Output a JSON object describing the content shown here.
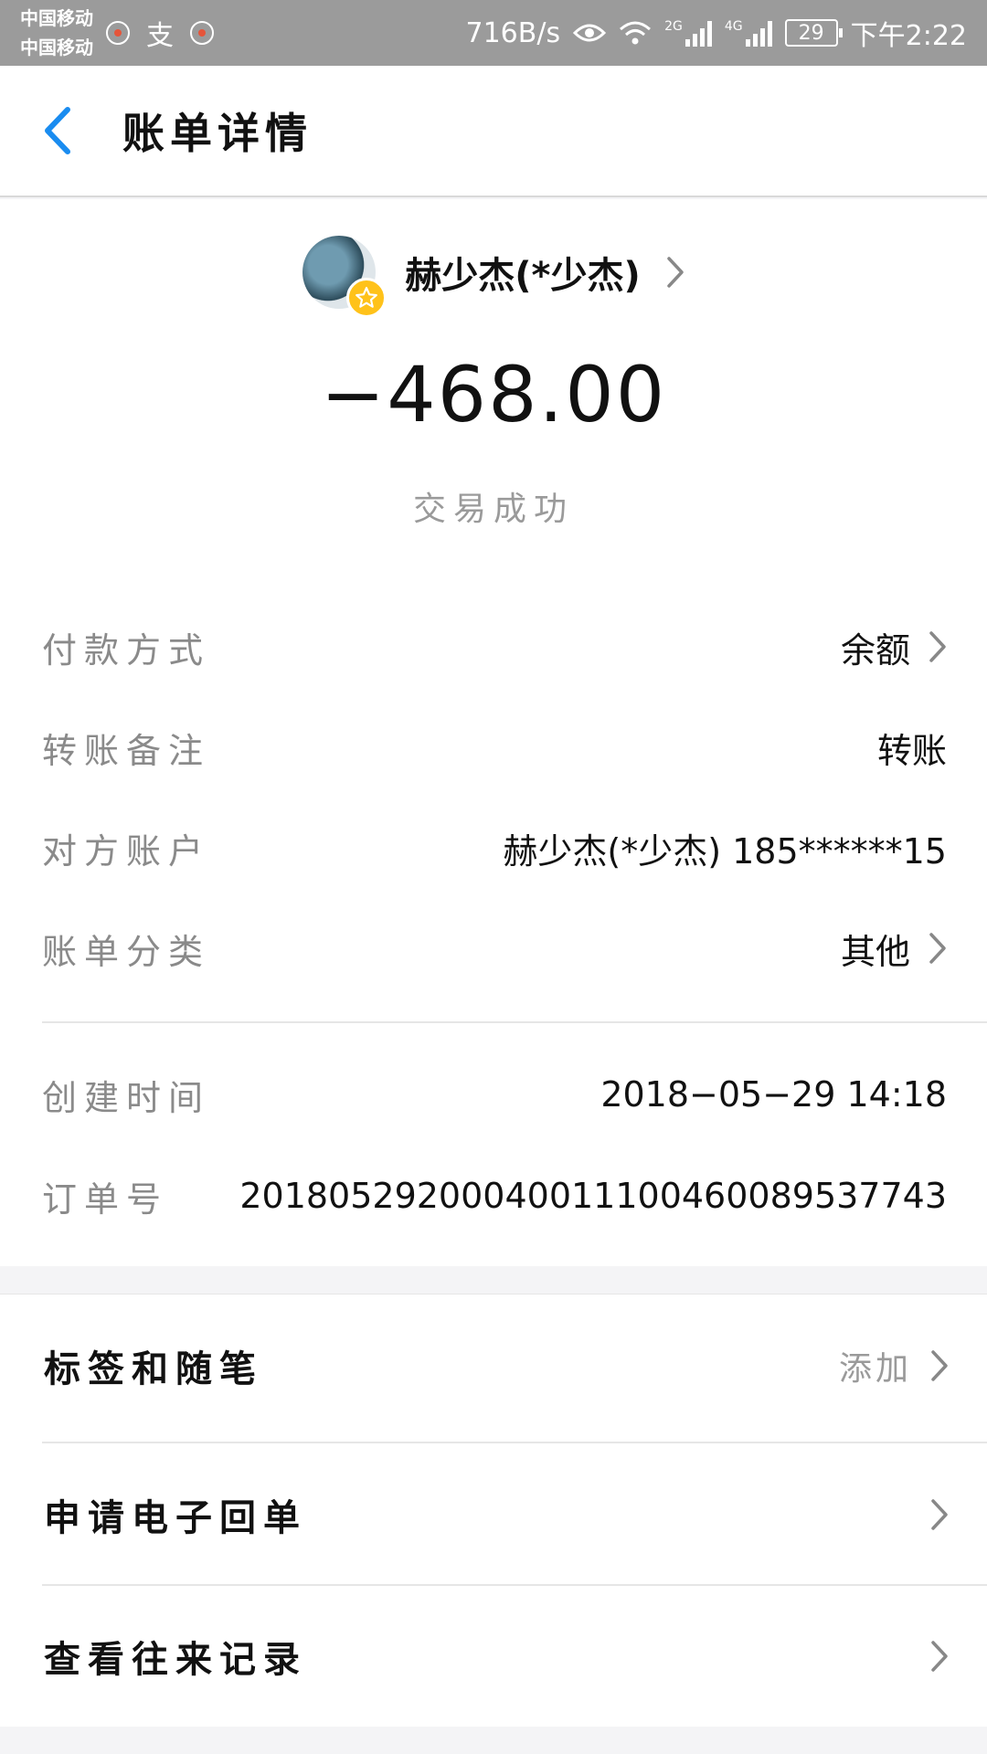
{
  "status_bar": {
    "carrier_1": "中国移动",
    "carrier_2": "中国移动",
    "app_char": "支",
    "speed": "716B/s",
    "net_2g": "2G",
    "net_4g": "4G",
    "battery": "29",
    "time": "下午2:22"
  },
  "header": {
    "title": "账单详情"
  },
  "payee": {
    "name": "赫少杰(*少杰)"
  },
  "transaction": {
    "amount": "−468.00",
    "status": "交易成功"
  },
  "details": {
    "payment_method_label": "付款方式",
    "payment_method_value": "余额",
    "note_label": "转账备注",
    "note_value": "转账",
    "account_label": "对方账户",
    "account_value": "赫少杰(*少杰) 185******15",
    "category_label": "账单分类",
    "category_value": "其他",
    "created_label": "创建时间",
    "created_value": "2018−05−29 14:18",
    "order_label": "订单号",
    "order_value": "20180529200040011100460089537743"
  },
  "actions": {
    "tags_label": "标签和随笔",
    "tags_value": "添加",
    "receipt_label": "申请电子回单",
    "history_label": "查看往来记录"
  },
  "colors": {
    "accent_blue": "#1a8cf0",
    "status_bar": "#9b9b9b",
    "star_badge": "#ffc21a"
  }
}
